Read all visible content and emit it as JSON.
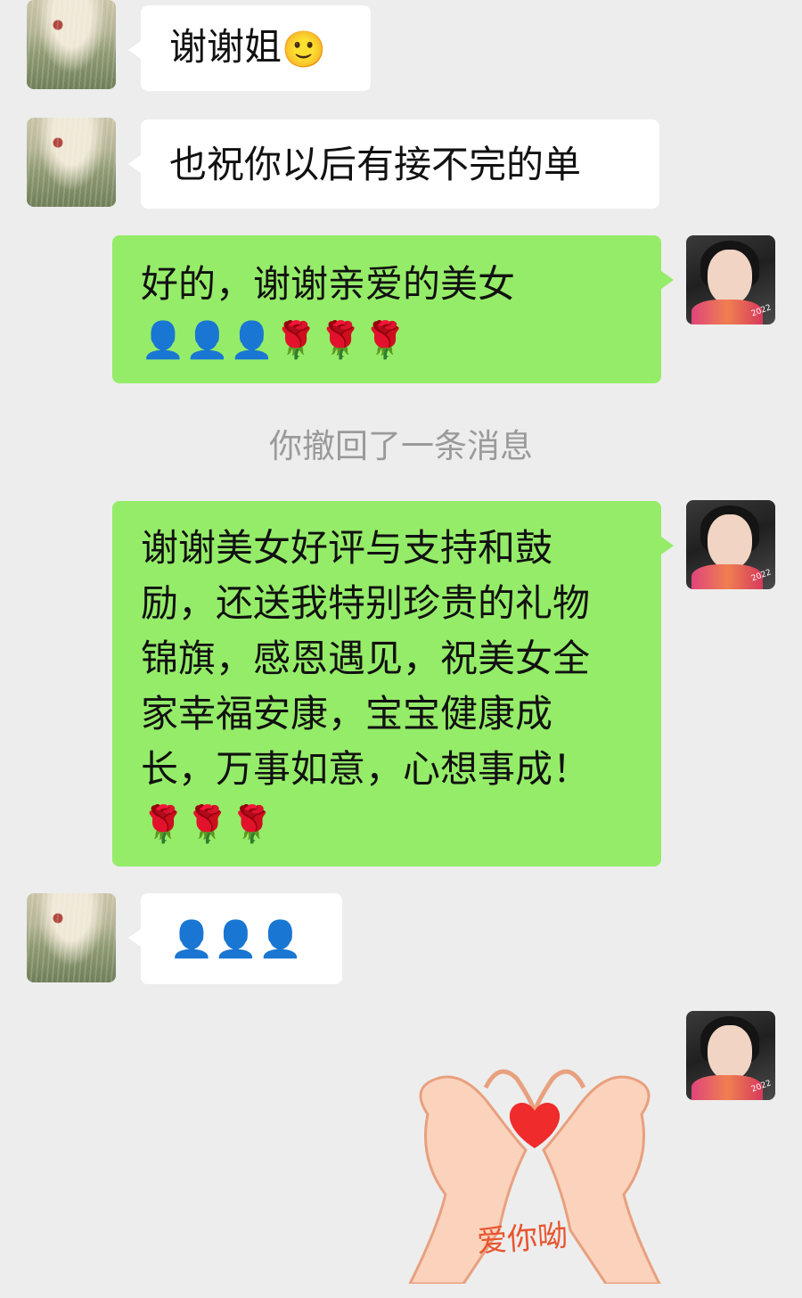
{
  "messages": [
    {
      "from": "other",
      "text": "谢谢姐",
      "emoji": "🙂"
    },
    {
      "from": "other",
      "text": "也祝你以后有接不完的单"
    },
    {
      "from": "me",
      "line1": "好的，谢谢亲爱的美女",
      "emoji_line": "👤👤👤🌹🌹🌹"
    },
    {
      "from": "me",
      "lines": [
        "谢谢美女好评与支持和鼓",
        "励，还送我特别珍贵的礼物",
        "锦旗，感恩遇见，祝美女全",
        "家幸福安康，宝宝健康成",
        "长，万事如意，心想事成！"
      ],
      "emoji_line": "🌹🌹🌹"
    },
    {
      "from": "other",
      "emoji_line": "👤👤👤"
    }
  ],
  "system_notice": "你撤回了一条消息",
  "sticker": {
    "caption": "爱你呦",
    "icon": "heart-hands-sticker"
  },
  "avatar_badge": "2022",
  "colors": {
    "background": "#ededed",
    "incoming_bubble": "#ffffff",
    "outgoing_bubble": "#95ec69"
  }
}
